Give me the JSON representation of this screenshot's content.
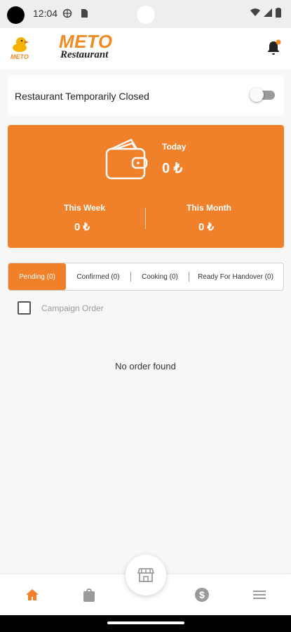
{
  "status_bar": {
    "time": "12:04"
  },
  "header": {
    "logo_small_text": "METO",
    "logo_title": "METO",
    "logo_subtitle": "Restaurant",
    "icons": [
      "bell-icon"
    ],
    "notification_dot_color": "#f08a24"
  },
  "closed_toggle": {
    "label": "Restaurant Temporarily Closed",
    "enabled": false
  },
  "earnings": {
    "today_label": "Today",
    "today_value": "0 ₺",
    "week_label": "This Week",
    "week_value": "0 ₺",
    "month_label": "This Month",
    "month_value": "0 ₺",
    "accent": "#f0802a"
  },
  "tabs": [
    {
      "label": "Pending (0)",
      "active": true
    },
    {
      "label": "Confirmed (0)",
      "active": false
    },
    {
      "label": "Cooking (0)",
      "active": false
    },
    {
      "label": "Ready For Handover (0)",
      "active": false
    }
  ],
  "campaign": {
    "label": "Campaign Order",
    "checked": false
  },
  "empty_message": "No order found",
  "bottom_nav": {
    "items": [
      "home-icon",
      "bag-icon",
      "store-icon",
      "dollar-icon",
      "menu-icon"
    ],
    "active": "home-icon",
    "active_color": "#f0802a",
    "inactive_color": "#9a9a9a"
  }
}
